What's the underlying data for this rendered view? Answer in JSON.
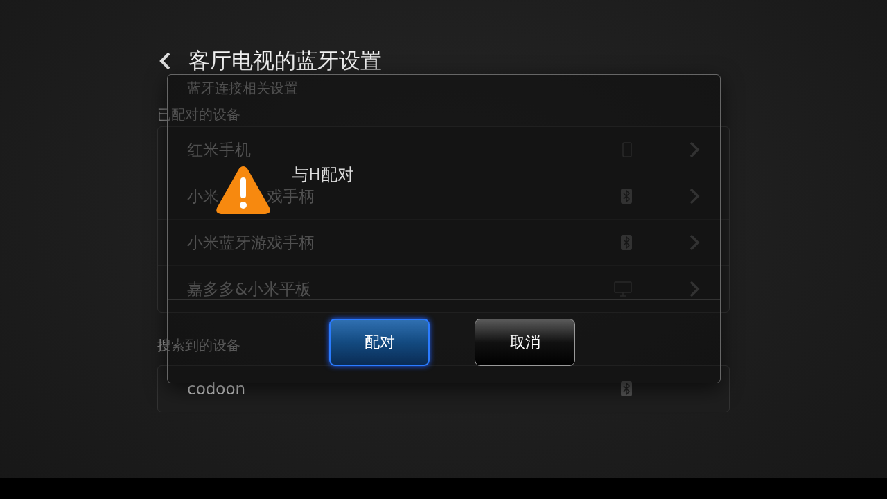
{
  "header": {
    "title": "客厅电视的蓝牙设置",
    "subtitle": "蓝牙连接相关设置"
  },
  "paired": {
    "heading": "已配对的设备",
    "devices": [
      {
        "name": "红米手机",
        "kind": "phone"
      },
      {
        "name": "小米",
        "name_after_covered": "戏手柄",
        "kind": "bluetooth"
      },
      {
        "name": "小米蓝牙游戏手柄",
        "kind": "bluetooth"
      },
      {
        "name": "嘉多多&小米平板",
        "kind": "monitor"
      }
    ]
  },
  "found": {
    "heading": "搜索到的设备",
    "devices": [
      {
        "name": "codoon",
        "kind": "bluetooth"
      }
    ]
  },
  "dialog": {
    "message": "与H配对",
    "buttons": [
      {
        "label": "配对",
        "selected": true
      },
      {
        "label": "取消",
        "selected": false
      }
    ]
  }
}
